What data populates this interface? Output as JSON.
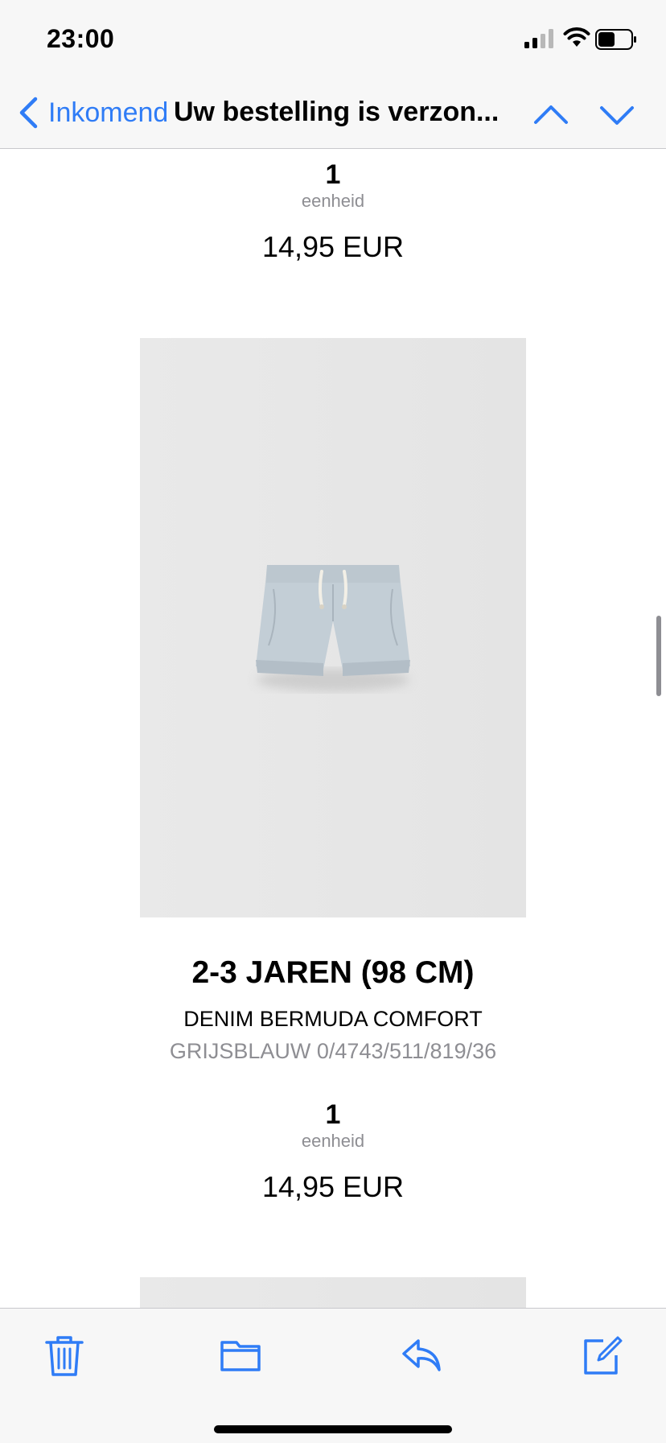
{
  "status": {
    "time": "23:00"
  },
  "nav": {
    "back_label": "Inkomend",
    "title": "Uw bestelling is verzon..."
  },
  "items": [
    {
      "quantity": "1",
      "unit": "eenheid",
      "price": "14,95 EUR"
    },
    {
      "size": "2-3 JAREN (98 CM)",
      "name": "DENIM BERMUDA COMFORT",
      "reference": "GRIJSBLAUW 0/4743/511/819/36",
      "quantity": "1",
      "unit": "eenheid",
      "price": "14,95 EUR"
    }
  ],
  "toolbar": {
    "icons": [
      "trash-icon",
      "folder-icon",
      "reply-icon",
      "compose-icon"
    ]
  },
  "colors": {
    "accent": "#2f7cf6",
    "secondary_text": "#8e8e93"
  }
}
